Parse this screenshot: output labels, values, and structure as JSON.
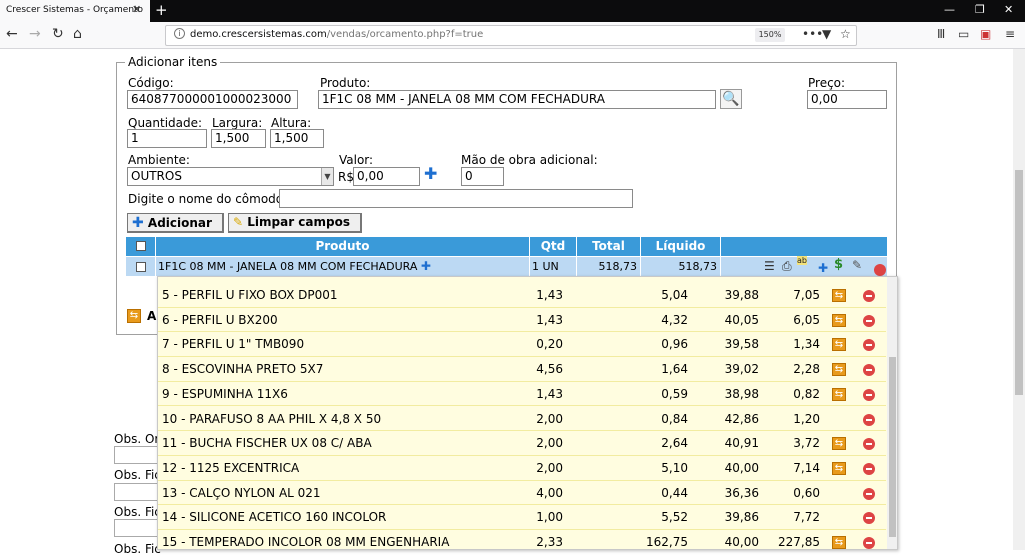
{
  "browser": {
    "tab_title": "Crescer Sistemas - Orçamento",
    "url_domain": "demo.crescersistemas.com",
    "url_path": "/vendas/orcamento.php?f=true",
    "zoom": "150%"
  },
  "form": {
    "legend": "Adicionar itens",
    "codigo_label": "Código:",
    "codigo_value": "64087700000100002300​0",
    "produto_label": "Produto:",
    "produto_value": "1F1C 08 MM - JANELA 08 MM COM FECHADURA",
    "preco_label": "Preço:",
    "preco_value": "0,00",
    "quantidade_label": "Quantidade:",
    "quantidade_value": "1",
    "largura_label": "Largura:",
    "largura_value": "1,500",
    "altura_label": "Altura:",
    "altura_value": "1,500",
    "ambiente_label": "Ambiente:",
    "ambiente_value": "OUTROS",
    "valor_label": "Valor:",
    "valor_prefix": "R$",
    "valor_value": "0,00",
    "mao_obra_label": "Mão de obra adicional:",
    "mao_obra_value": "0",
    "comodo_label": "Digite o nome do cômodo:",
    "comodo_value": "",
    "adicionar_label": "Adicionar",
    "limpar_label": "Limpar campos",
    "second_button_partial": "A"
  },
  "table": {
    "headers": {
      "produto": "Produto",
      "qtd": "Qtd",
      "total": "Total",
      "liquido": "Líquido"
    },
    "row": {
      "produto": "1F1C 08 MM - JANELA 08 MM COM FECHADURA",
      "qtd": "1 UN",
      "total": "518,73",
      "liquido": "518,73"
    }
  },
  "subitems": [
    {
      "name": "5 - PERFIL U FIXO BOX DP001",
      "qty": "1,43",
      "unit": "5,04",
      "pct": "39,88",
      "total": "7,05",
      "refresh": true
    },
    {
      "name": "6 - PERFIL U BX200",
      "qty": "1,43",
      "unit": "4,32",
      "pct": "40,05",
      "total": "6,05",
      "refresh": true
    },
    {
      "name": "7 - PERFIL U 1\" TMB090",
      "qty": "0,20",
      "unit": "0,96",
      "pct": "39,58",
      "total": "1,34",
      "refresh": true
    },
    {
      "name": "8 - ESCOVINHA PRETO 5X7",
      "qty": "4,56",
      "unit": "1,64",
      "pct": "39,02",
      "total": "2,28",
      "refresh": true
    },
    {
      "name": "9 - ESPUMINHA 11X6",
      "qty": "1,43",
      "unit": "0,59",
      "pct": "38,98",
      "total": "0,82",
      "refresh": true
    },
    {
      "name": "10 - PARAFUSO 8 AA PHIL X 4,8 X 50",
      "qty": "2,00",
      "unit": "0,84",
      "pct": "42,86",
      "total": "1,20",
      "refresh": false
    },
    {
      "name": "11 - BUCHA FISCHER UX 08 C/ ABA",
      "qty": "2,00",
      "unit": "2,64",
      "pct": "40,91",
      "total": "3,72",
      "refresh": true
    },
    {
      "name": "12 - 1125 EXCENTRICA",
      "qty": "2,00",
      "unit": "5,10",
      "pct": "40,00",
      "total": "7,14",
      "refresh": true
    },
    {
      "name": "13 - CALÇO NYLON AL 021",
      "qty": "4,00",
      "unit": "0,44",
      "pct": "36,36",
      "total": "0,60",
      "refresh": false
    },
    {
      "name": "14 - SILICONE ACETICO 160 INCOLOR",
      "qty": "1,00",
      "unit": "5,52",
      "pct": "39,86",
      "total": "7,72",
      "refresh": false
    },
    {
      "name": "15 - TEMPERADO INCOLOR 08 MM ENGENHARIA",
      "qty": "2,33",
      "unit": "162,75",
      "pct": "40,00",
      "total": "227,85",
      "refresh": true
    }
  ],
  "obs": {
    "obs1": "Obs. Or",
    "obs2": "Obs. Fic",
    "obs3": "Obs. Fic",
    "obs4": "Obs. Fic"
  }
}
